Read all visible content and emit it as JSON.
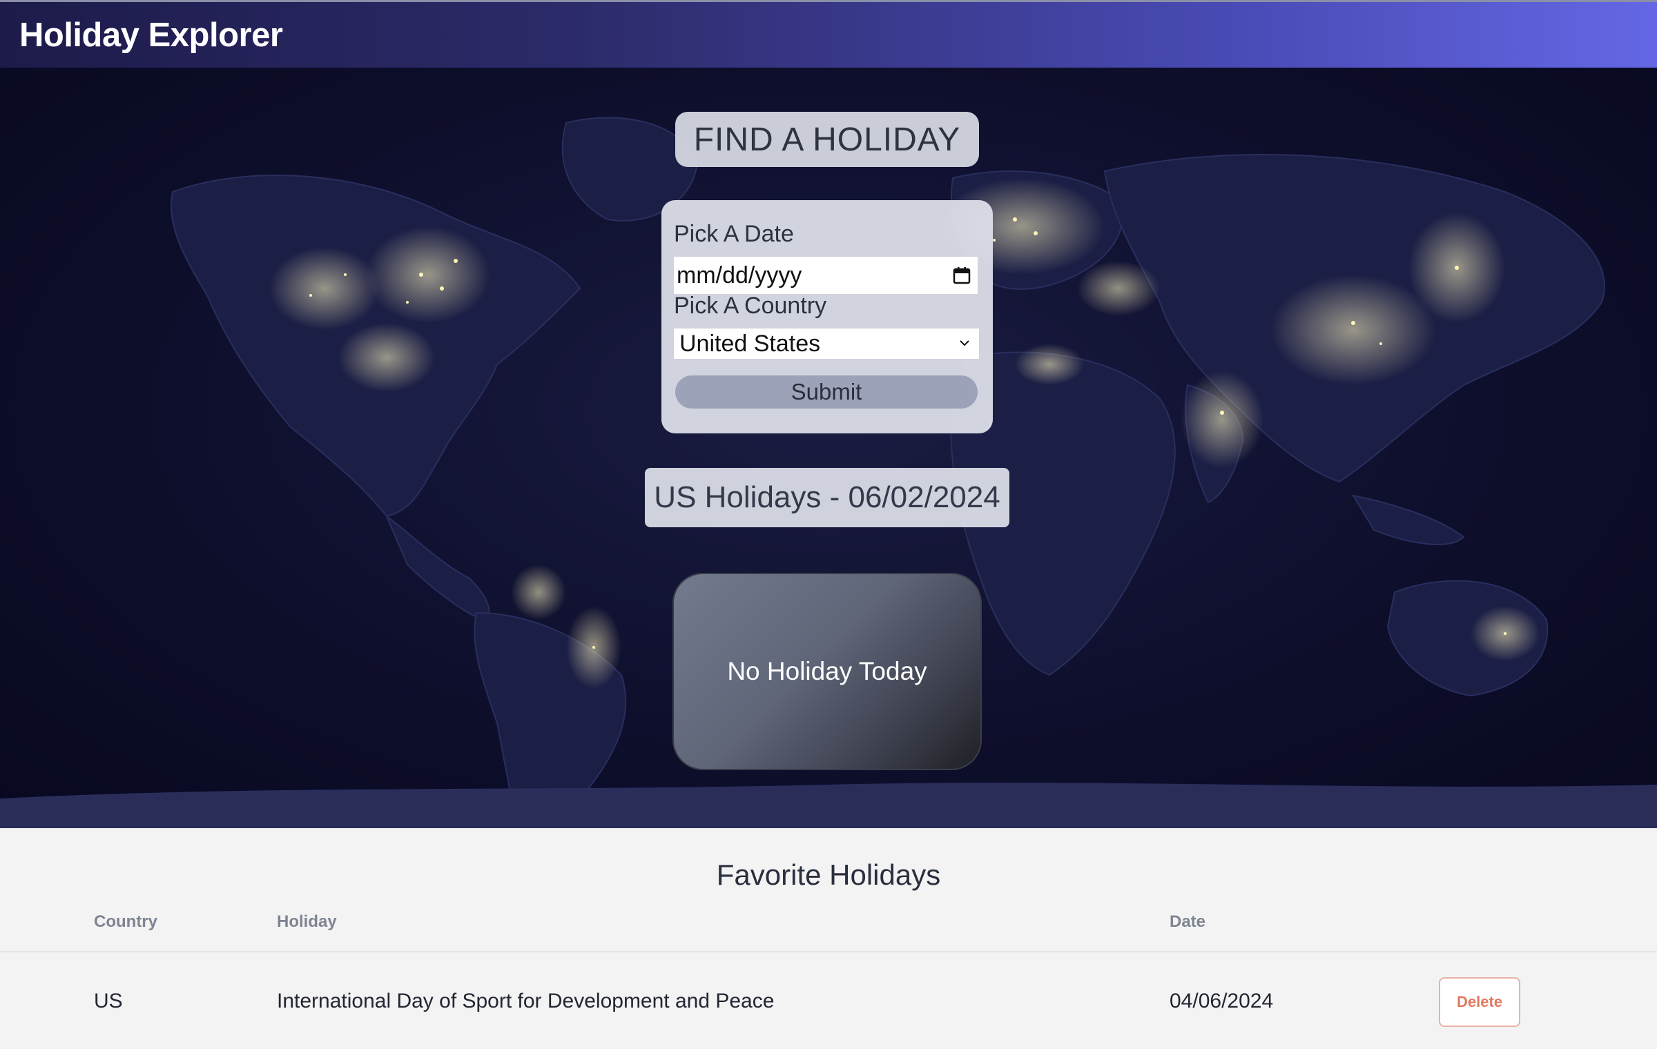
{
  "header": {
    "title": "Holiday Explorer"
  },
  "search": {
    "heading": "FIND A HOLIDAY",
    "date_label": "Pick A Date",
    "date_placeholder": "mm/dd/yyyy",
    "country_label": "Pick A Country",
    "country_selected": "United States",
    "submit_label": "Submit"
  },
  "result": {
    "heading": "US Holidays - 06/02/2024",
    "message": "No Holiday Today"
  },
  "favorites": {
    "title": "Favorite Holidays",
    "columns": [
      "Country",
      "Holiday",
      "Date"
    ],
    "rows": [
      {
        "country": "US",
        "holiday": "International Day of Sport for Development and Peace",
        "date": "04/06/2024",
        "action": "Delete"
      }
    ]
  },
  "colors": {
    "header_start": "#1d1b4a",
    "header_end": "#6467e4",
    "delete_accent": "#e07a5f"
  },
  "icons": [
    "calendar-icon",
    "chevron-down-icon"
  ]
}
